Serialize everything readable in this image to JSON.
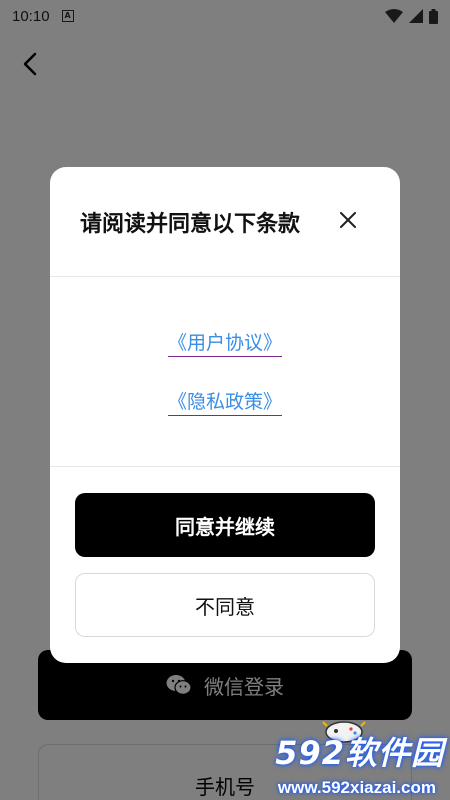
{
  "status_bar": {
    "time": "10:10",
    "notification_icon": "a-notification-icon",
    "wifi_icon": "wifi-icon",
    "signal_icon": "signal-icon",
    "battery_icon": "battery-icon"
  },
  "background": {
    "back_icon": "chevron-left-icon",
    "wechat_login": {
      "icon": "wechat-icon",
      "label": "微信登录"
    },
    "phone_login": {
      "label": "手机号"
    }
  },
  "modal": {
    "title": "请阅读并同意以下条款",
    "close_icon": "close-icon",
    "links": {
      "user_agreement": "《用户协议》",
      "privacy_policy": "《隐私政策》"
    },
    "agree_label": "同意并继续",
    "disagree_label": "不同意"
  },
  "watermark": {
    "main": "592软件园",
    "url": "www.592xiazai.com"
  },
  "colors": {
    "overlay": "#7f7f7f",
    "link": "#3a8ee6",
    "primary_button": "#000000",
    "watermark_glow": "#1a5cff"
  }
}
